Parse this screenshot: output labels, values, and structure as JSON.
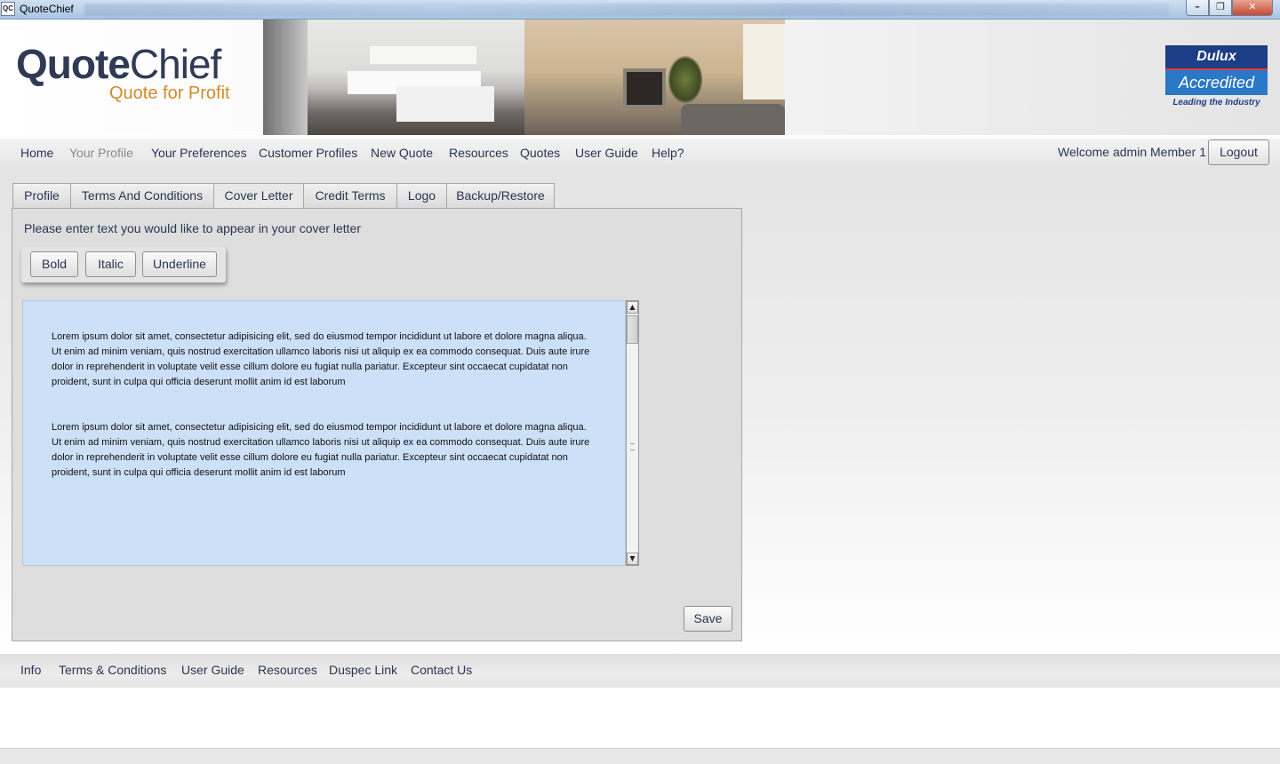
{
  "window": {
    "title": "QuoteChief",
    "icon_text": "QC",
    "controls": [
      "minimize-icon",
      "maximize-icon",
      "close-icon"
    ]
  },
  "header": {
    "brand_bold": "Quote",
    "brand_light": "Chief",
    "tagline": "Quote for Profit",
    "badge": {
      "top": "Dulux",
      "middle": "Accredited",
      "bottom": "Leading the Industry"
    }
  },
  "nav": {
    "items": [
      "Home",
      "Your Profile",
      "Your Preferences",
      "Customer Profiles",
      "New Quote",
      "Resources",
      "Quotes",
      "User Guide",
      "Help?"
    ],
    "welcome": "Welcome admin Member 1",
    "logout": "Logout"
  },
  "tabs": [
    "Profile",
    "Terms And Conditions",
    "Cover Letter",
    "Credit Terms",
    "Logo",
    "Backup/Restore"
  ],
  "active_tab": "Cover Letter",
  "cover_letter": {
    "prompt": "Please enter text you would like to appear in your cover letter",
    "format_buttons": {
      "bold": "Bold",
      "italic": "Italic",
      "underline": "Underline"
    },
    "paragraphs": [
      "Lorem ipsum dolor sit amet, consectetur adipisicing elit, sed do eiusmod tempor incididunt ut labore et dolore magna aliqua. Ut enim ad minim veniam, quis nostrud exercitation ullamco laboris nisi ut aliquip ex ea commodo consequat. Duis aute irure dolor in reprehenderit in voluptate velit esse cillum dolore eu fugiat nulla pariatur. Excepteur sint occaecat cupidatat non proident, sunt in culpa qui officia deserunt mollit anim id est laborum",
      "Lorem ipsum dolor sit amet, consectetur adipisicing elit, sed do eiusmod tempor incididunt ut labore et dolore magna aliqua. Ut enim ad minim veniam, quis nostrud exercitation ullamco laboris nisi ut aliquip ex ea commodo consequat. Duis aute irure dolor in reprehenderit in voluptate velit esse cillum dolore eu fugiat nulla pariatur. Excepteur sint occaecat cupidatat non proident, sunt in culpa qui officia deserunt mollit anim id est laborum"
    ],
    "save": "Save"
  },
  "footer": {
    "links": [
      "Info",
      "Terms & Conditions",
      "User Guide",
      "Resources",
      "Duspec Link",
      "Contact Us"
    ]
  },
  "colors": {
    "nav_text": "#2a3550",
    "editor_bg": "#cce0f8",
    "tagline": "#d18a2a",
    "badge_blue": "#1d3e86"
  }
}
